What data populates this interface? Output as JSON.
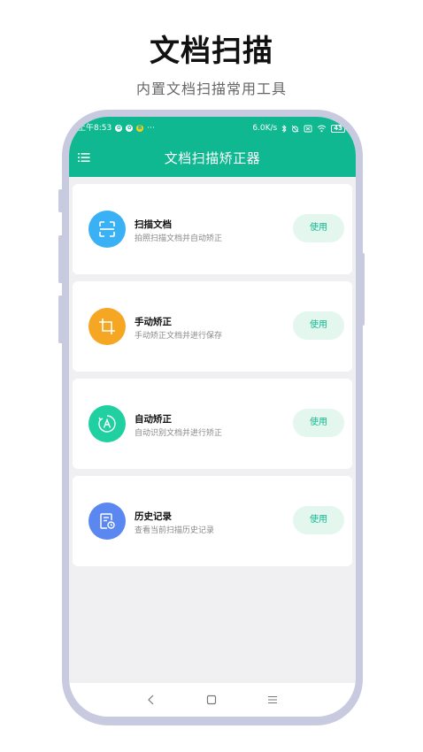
{
  "promo": {
    "title": "文档扫描",
    "subtitle": "内置文档扫描常用工具"
  },
  "status_bar": {
    "time": "上午8:53",
    "badges": [
      "✿",
      "✿",
      "B"
    ],
    "more": "···",
    "speed": "6.0K/s",
    "battery": "43",
    "icons": [
      "bluetooth-icon",
      "alarm-off-icon",
      "sim-icon",
      "wifi-icon",
      "battery-icon"
    ]
  },
  "header": {
    "title": "文档扫描矫正器",
    "menu_icon": "hamburger-menu-icon"
  },
  "colors": {
    "primary": "#0fb890",
    "button_bg": "#e3f7ef",
    "scan_icon": "#3ab0f5",
    "manual_icon": "#f5a623",
    "auto_icon": "#20d0a0",
    "history_icon": "#5b87f0"
  },
  "cards": [
    {
      "icon": "scan-frame-icon",
      "title": "扫描文档",
      "desc": "拍照扫描文档并自动矫正",
      "button": "使用"
    },
    {
      "icon": "crop-icon",
      "title": "手动矫正",
      "desc": "手动矫正文档并进行保存",
      "button": "使用"
    },
    {
      "icon": "auto-a-icon",
      "title": "自动矫正",
      "desc": "自动识别文档并进行矫正",
      "button": "使用"
    },
    {
      "icon": "history-document-icon",
      "title": "历史记录",
      "desc": "查看当前扫描历史记录",
      "button": "使用"
    }
  ],
  "nav_bar": {
    "icons": [
      "back-icon",
      "home-icon",
      "menu-icon"
    ]
  }
}
